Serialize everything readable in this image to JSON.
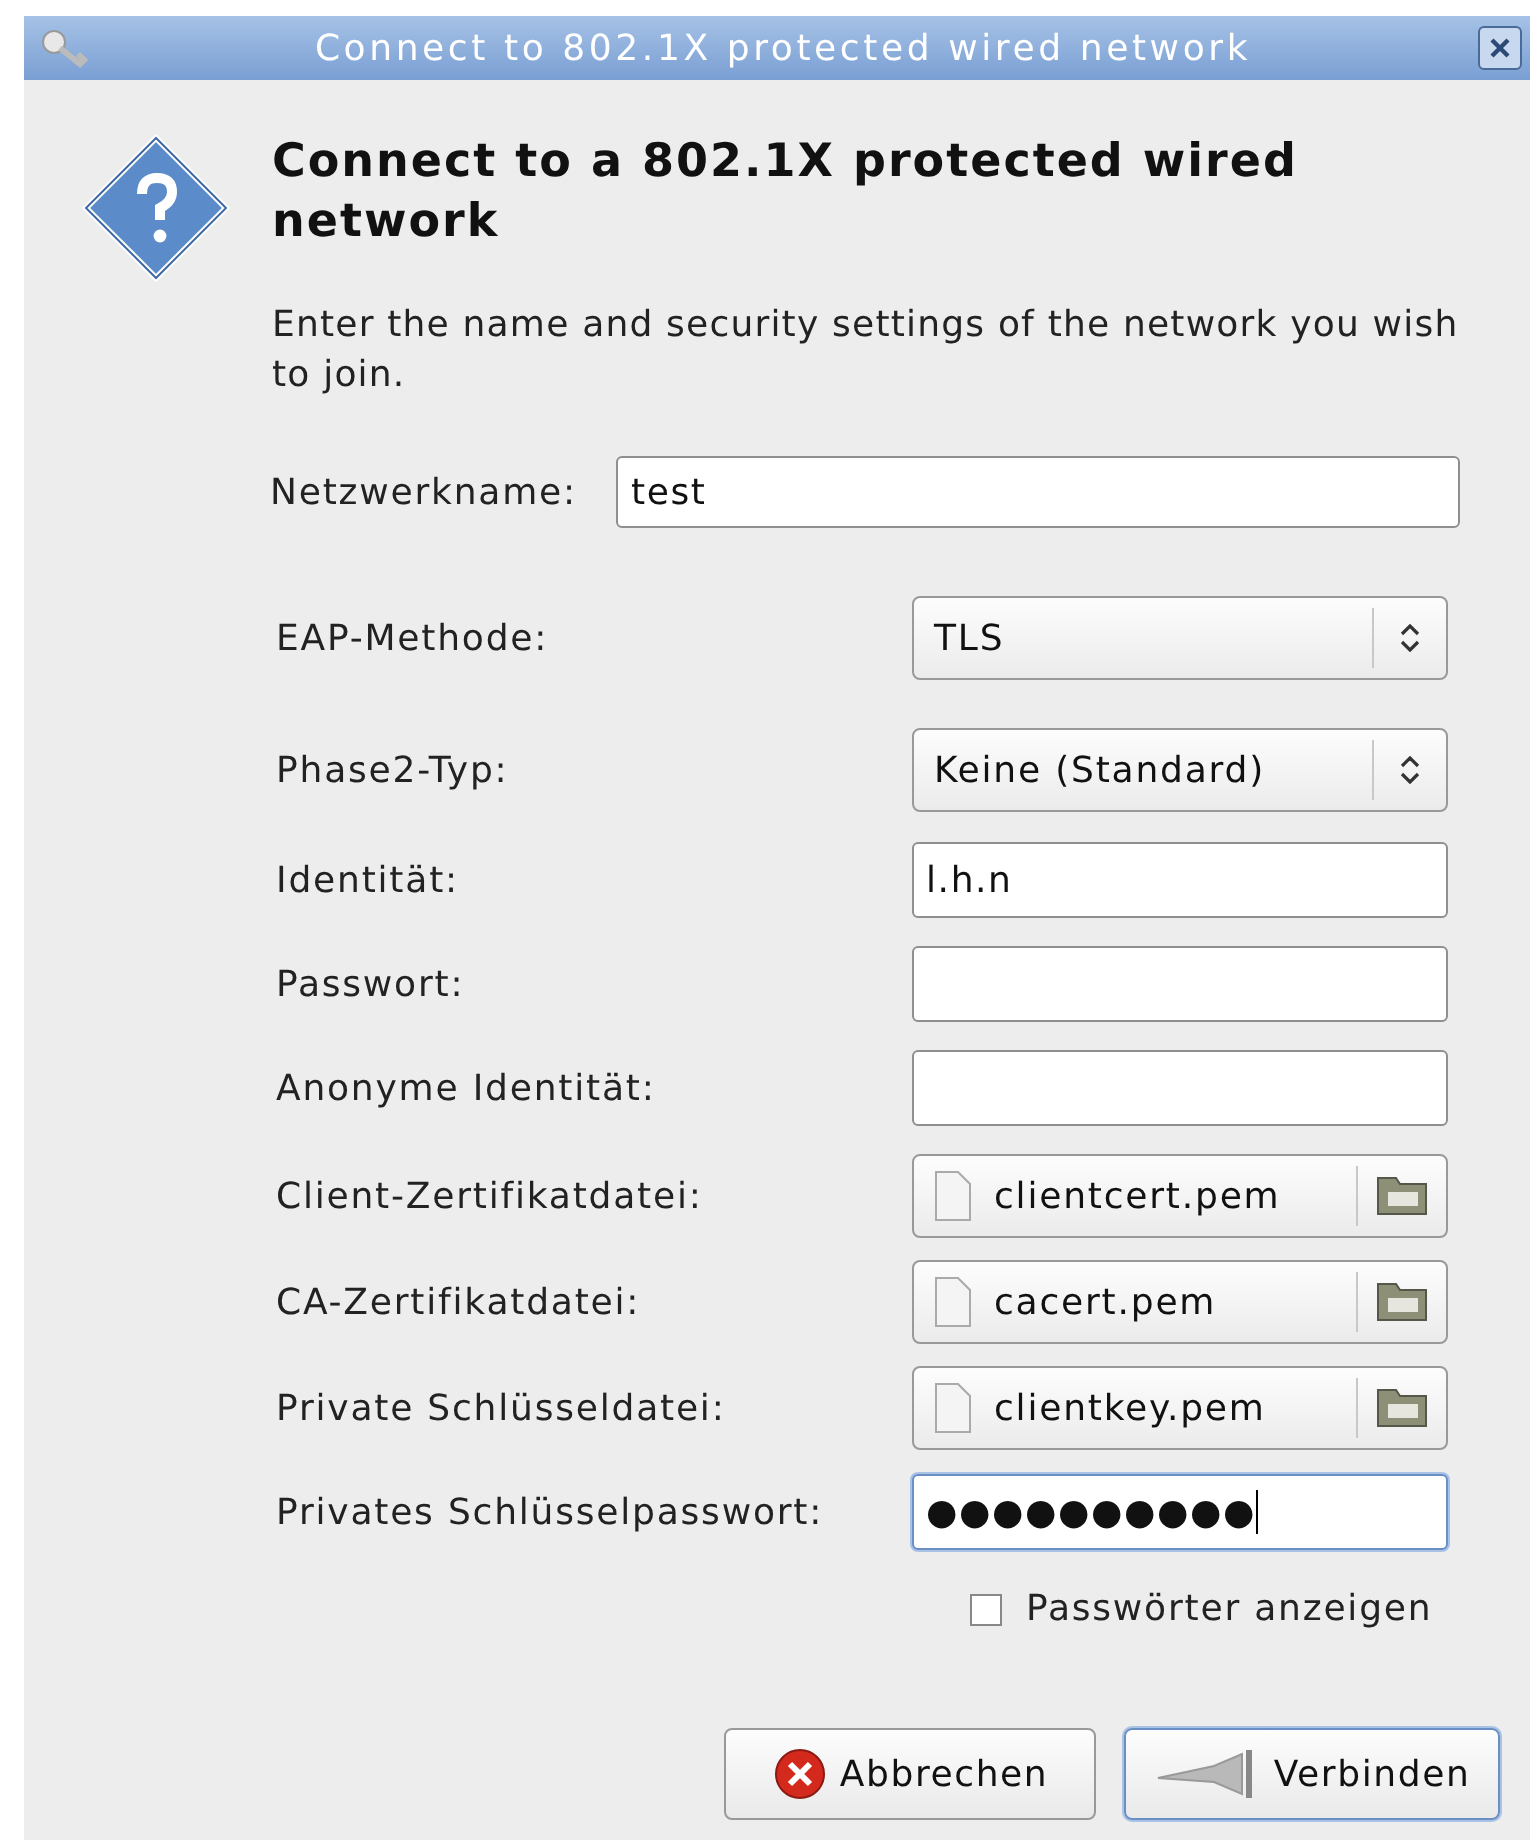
{
  "window": {
    "title": "Connect to 802.1X protected wired network"
  },
  "heading": "Connect to a 802.1X protected wired network",
  "description": "Enter the name and security settings of the network you wish to join.",
  "network_name": {
    "label": "Netzwerkname:",
    "value": "test"
  },
  "fields": [
    {
      "kind": "combo",
      "label": "EAP-Methode:",
      "value": "TLS"
    },
    {
      "kind": "combo",
      "label": "Phase2-Typ:",
      "value": "Keine (Standard)"
    },
    {
      "kind": "text",
      "label": "Identität:",
      "value": "l.h.n",
      "focused": false
    },
    {
      "kind": "text",
      "label": "Passwort:",
      "focused": false
    },
    {
      "kind": "text",
      "label": "Anonyme Identität:",
      "focused": false
    },
    {
      "kind": "file",
      "label": "Client-Zertifikatdatei:",
      "value": "clientcert.pem"
    },
    {
      "kind": "file",
      "label": "CA-Zertifikatdatei:",
      "value": "cacert.pem"
    },
    {
      "kind": "file",
      "label": "Private Schlüsseldatei:",
      "value": "clientkey.pem"
    },
    {
      "kind": "text",
      "label": "Privates Schlüsselpasswort:",
      "value": "●●●●●●●●●●",
      "focused": true
    }
  ],
  "show_passwords": {
    "label": "Passwörter anzeigen",
    "checked": false
  },
  "buttons": [
    {
      "kind": "cancel",
      "label": "Abbrechen",
      "default": false
    },
    {
      "kind": "connect",
      "label": "Verbinden",
      "default": true
    }
  ]
}
